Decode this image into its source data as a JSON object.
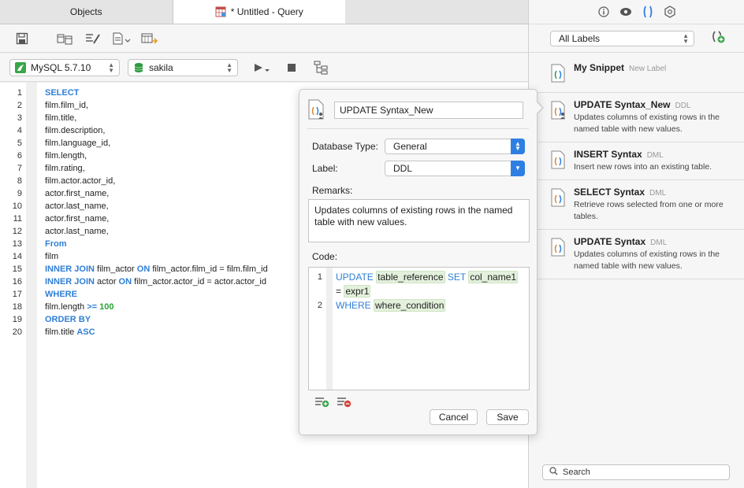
{
  "tabs": [
    {
      "label": "Objects"
    },
    {
      "label": "* Untitled - Query"
    }
  ],
  "toolbar": {
    "buttons": [
      "save-icon",
      "query-builder-icon",
      "beautify-icon",
      "code-snippet-icon",
      "export-icon"
    ]
  },
  "connection": {
    "server": "MySQL 5.7.10",
    "database": "sakila",
    "colors": {
      "server_icon": "#3aa54a",
      "db_icon": "#2f9a3e"
    }
  },
  "editor": {
    "lines": [
      "SELECT",
      "film.film_id,",
      "film.title,",
      "film.description,",
      "film.language_id,",
      "film.length,",
      "film.rating,",
      "film.actor.actor_id,",
      "actor.first_name,",
      "actor.last_name,",
      "actor.first_name,",
      "actor.last_name,",
      "From",
      "film",
      "INNER JOIN film_actor ON film_actor.film_id = film.film_id",
      "INNER JOIN actor ON film_actor.actor_id = actor.actor_id",
      "WHERE",
      "film.length >= 100",
      "ORDER BY",
      "film.title ASC"
    ],
    "line_numbers": [
      "1",
      "2",
      "3",
      "4",
      "5",
      "6",
      "7",
      "8",
      "9",
      "10",
      "11",
      "12",
      "13",
      "14",
      "15",
      "16",
      "17",
      "18",
      "19",
      "20"
    ]
  },
  "popover": {
    "name": "UPDATE Syntax_New",
    "database_type_label": "Database Type:",
    "database_type": "General",
    "label_label": "Label:",
    "label": "DDL",
    "remarks_label": "Remarks:",
    "remarks": "Updates columns of existing rows in the named table with new values.",
    "code_label": "Code:",
    "code": {
      "l1_kw1": "UPDATE",
      "l1_ph1": "table_reference",
      "l1_kw2": "SET",
      "l1_ph2": "col_name1",
      "l1b_eq": "=",
      "l1b_ph": "expr1",
      "l2_kw": "WHERE",
      "l2_ph": "where_condition",
      "n1": "1",
      "n2": "2"
    },
    "cancel": "Cancel",
    "save": "Save"
  },
  "right_panel": {
    "labels_filter": "All Labels",
    "snippets": [
      {
        "title": "My Snippet",
        "tag": "New Label",
        "desc": ""
      },
      {
        "title": "UPDATE Syntax_New",
        "tag": "DDL",
        "desc": "Updates columns of existing rows in the named table with new values."
      },
      {
        "title": "INSERT Syntax",
        "tag": "DML",
        "desc": "Insert new rows into an existing table."
      },
      {
        "title": "SELECT Syntax",
        "tag": "DML",
        "desc": "Retrieve rows selected from one or more tables."
      },
      {
        "title": "UPDATE Syntax",
        "tag": "DML",
        "desc": "Updates columns of existing rows in the named table with new values."
      }
    ],
    "search_placeholder": "Search"
  },
  "colors": {
    "accent": "#2f7fe3",
    "keyword": "#2f7fd6",
    "number": "#27a532"
  }
}
